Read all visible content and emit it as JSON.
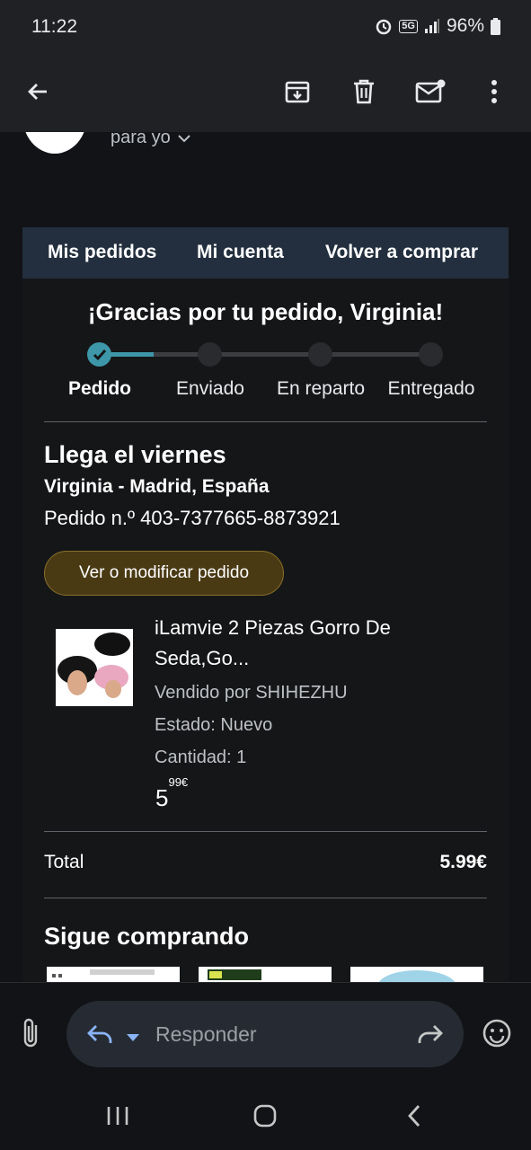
{
  "status_bar": {
    "time": "11:22",
    "network": "5G",
    "battery": "96%"
  },
  "header": {
    "icons": [
      "back-arrow-icon",
      "archive-icon",
      "delete-icon",
      "mark-unread-icon",
      "more-vert-icon"
    ]
  },
  "email": {
    "recipient": "para yo"
  },
  "amazon_nav": {
    "links": [
      "Mis pedidos",
      "Mi cuenta",
      "Volver a comprar"
    ]
  },
  "thanks_message": "¡Gracias por tu pedido, Virginia!",
  "progress": {
    "steps": [
      "Pedido",
      "Enviado",
      "En reparto",
      "Entregado"
    ],
    "current_step": 1,
    "accent_color": "#3d97a8"
  },
  "delivery": {
    "arrival": "Llega el viernes",
    "address": "Virginia - Madrid, España",
    "order_number": "Pedido n.º 403-7377665-8873921",
    "view_button": "Ver o modificar pedido"
  },
  "product": {
    "title_line1": "iLamvie 2 Piezas Gorro De",
    "title_line2": "Seda,Go...",
    "seller": "Vendido por SHIHEZHU",
    "condition": "Estado: Nuevo",
    "quantity": "Cantidad: 1",
    "price_whole": "5",
    "price_fraction": "99€"
  },
  "totals": {
    "label": "Total",
    "value": "5.99€"
  },
  "recommendations": {
    "heading": "Sigue comprando"
  },
  "reply_bar": {
    "placeholder": "Responder"
  }
}
